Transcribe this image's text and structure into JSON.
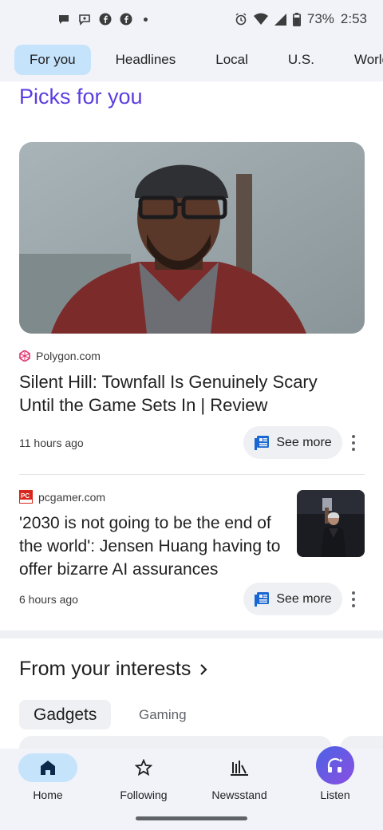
{
  "status_bar": {
    "battery": "73%",
    "time": "2:53",
    "icons": [
      "chat-icon",
      "messenger-icon",
      "facebook-icon",
      "facebook-icon",
      "dot-icon",
      "alarm-icon",
      "wifi-icon",
      "signal-icon",
      "battery-icon"
    ]
  },
  "tabs": [
    {
      "label": "For you",
      "active": true
    },
    {
      "label": "Headlines",
      "active": false
    },
    {
      "label": "Local",
      "active": false
    },
    {
      "label": "U.S.",
      "active": false
    },
    {
      "label": "World",
      "active": false
    }
  ],
  "picks": {
    "title": "Picks for you",
    "articles": [
      {
        "source": "Polygon.com",
        "headline_line1": "Silent Hill: Townfall Is Genuinely Scary",
        "headline_line2": "Until the Game Sets In | Review",
        "time": "11 hours ago",
        "see_more": "See more"
      },
      {
        "source": "pcgamer.com",
        "headline_line1": "'2030 is not going to be the end of",
        "headline_line2": "the world': Jensen Huang having to",
        "headline_line3": "offer bizarre AI assurances",
        "time": "6 hours ago",
        "see_more": "See more"
      }
    ]
  },
  "interests": {
    "title": "From your interests",
    "chips": [
      {
        "label": "Gadgets",
        "active": true
      },
      {
        "label": "Gaming",
        "active": false
      }
    ]
  },
  "bottom_nav": [
    {
      "label": "Home",
      "icon": "home-icon",
      "active": true
    },
    {
      "label": "Following",
      "icon": "star-icon",
      "active": false
    },
    {
      "label": "Newsstand",
      "icon": "newsstand-icon",
      "active": false
    },
    {
      "label": "Listen",
      "icon": "headphones-icon",
      "active": false
    }
  ],
  "colors": {
    "accent": "#5b3ee0",
    "tab_active": "#c5e3fb",
    "polygon": "#e0336f",
    "pcgamer": "#d7261e"
  }
}
